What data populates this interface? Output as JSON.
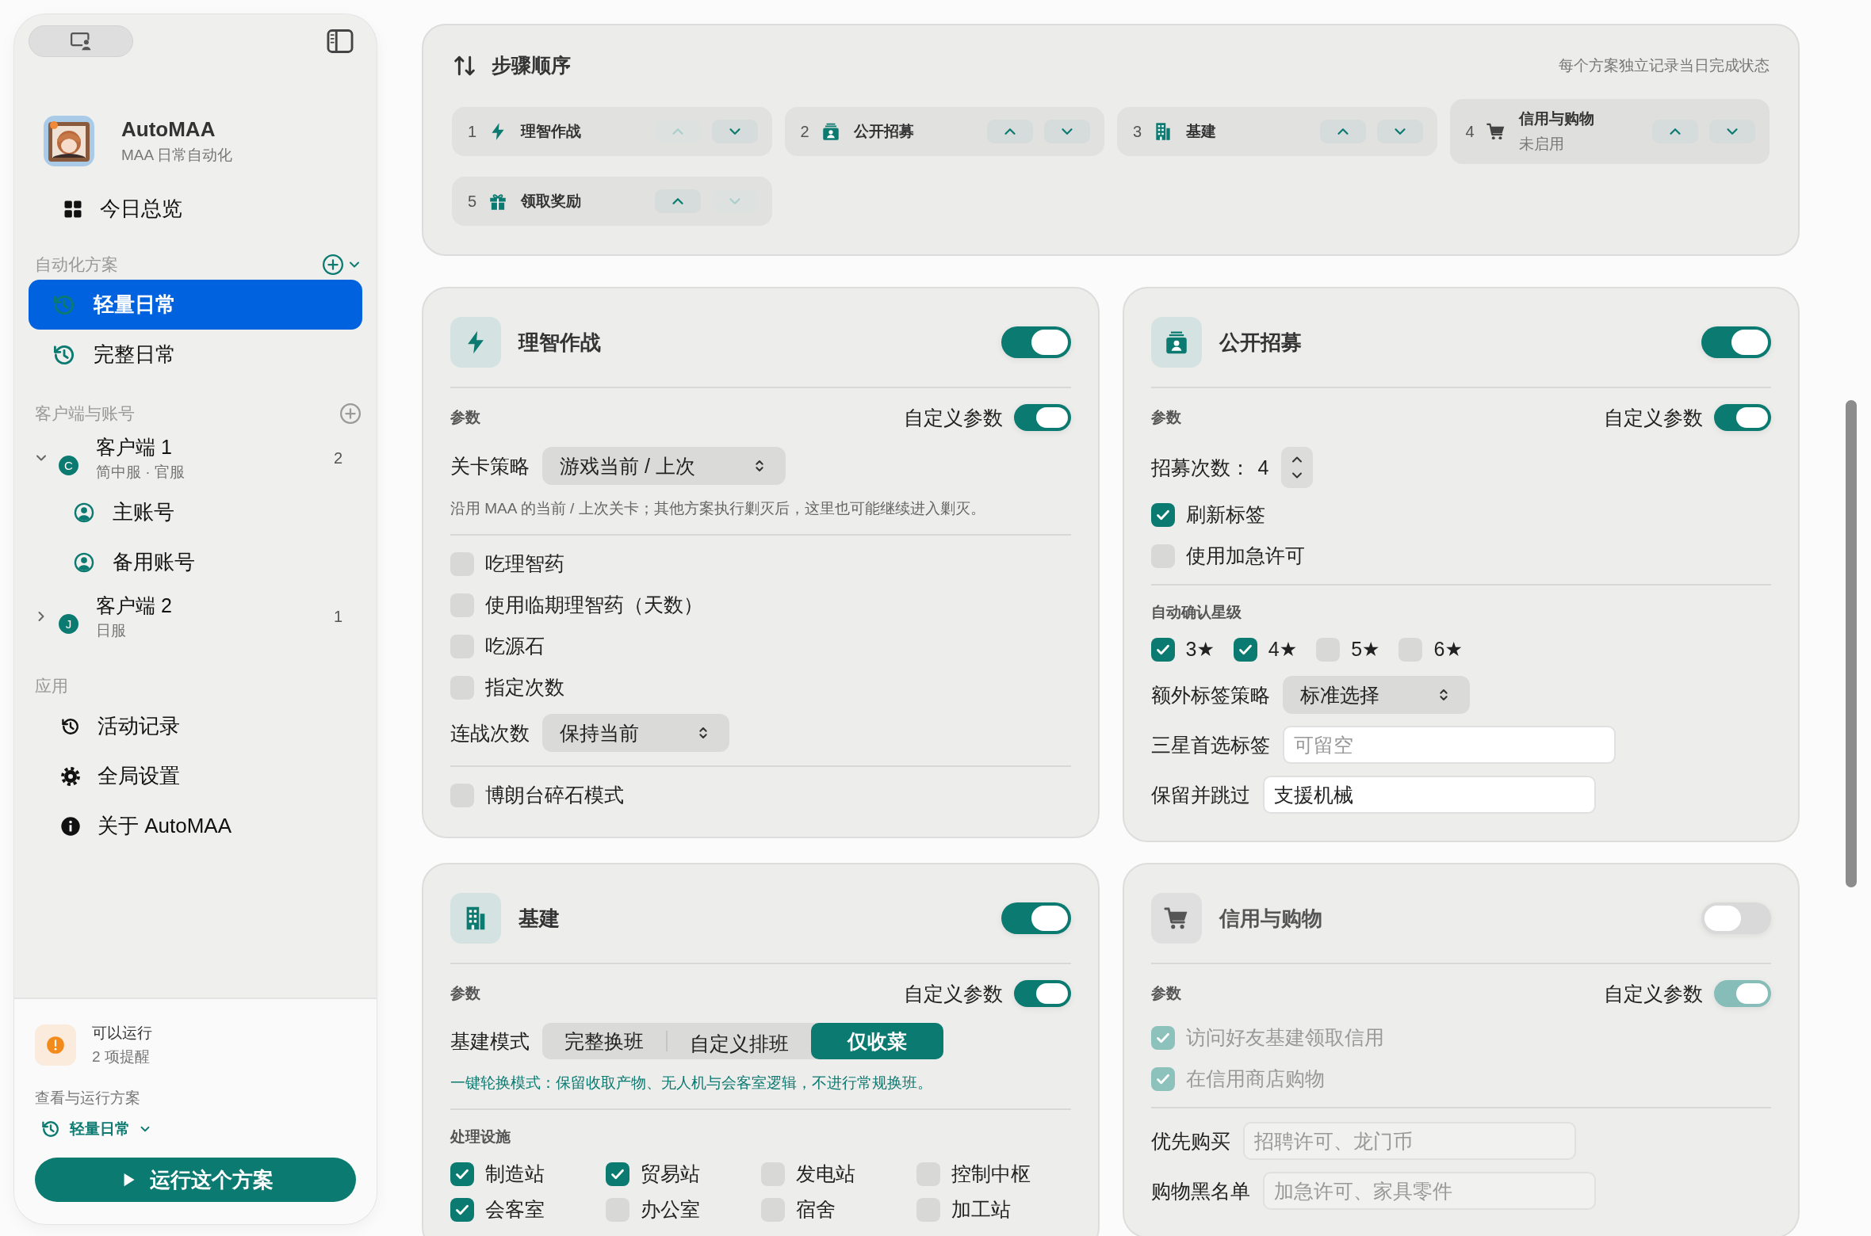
{
  "sidebar": {
    "app": {
      "name": "AutoMAA",
      "subtitle": "MAA 日常自动化"
    },
    "overview": "今日总览",
    "plans_header": "自动化方案",
    "plans": [
      {
        "label": "轻量日常",
        "selected": true
      },
      {
        "label": "完整日常",
        "selected": false
      }
    ],
    "clients_header": "客户端与账号",
    "clients": [
      {
        "name": "客户端 1",
        "badge": "C",
        "detail": "简中服 · 官服",
        "count": "2",
        "expanded": true,
        "children": [
          {
            "label": "主账号"
          },
          {
            "label": "备用账号"
          }
        ]
      },
      {
        "name": "客户端 2",
        "badge": "J",
        "detail": "日服",
        "count": "1",
        "expanded": false
      }
    ],
    "apps_header": "应用",
    "apps": [
      {
        "label": "活动记录",
        "kind": "history"
      },
      {
        "label": "全局设置",
        "kind": "settings"
      },
      {
        "label": "关于 AutoMAA",
        "kind": "info"
      }
    ],
    "status": {
      "title": "可以运行",
      "detail": "2 项提醒"
    },
    "run_label": "查看与运行方案",
    "run_plan": "轻量日常",
    "run_button": "运行这个方案"
  },
  "steps": {
    "title": "步骤顺序",
    "note": "每个方案独立记录当日完成状态",
    "items": [
      {
        "index": "1",
        "label": "理智作战",
        "kind": "bolt",
        "up_disabled": true,
        "down_disabled": false
      },
      {
        "index": "2",
        "label": "公开招募",
        "kind": "recruit",
        "up_disabled": false,
        "down_disabled": false
      },
      {
        "index": "3",
        "label": "基建",
        "kind": "building",
        "up_disabled": false,
        "down_disabled": false
      },
      {
        "index": "4",
        "label": "信用与购物",
        "status": "未启用",
        "kind": "cart",
        "up_disabled": false,
        "down_disabled": false
      },
      {
        "index": "5",
        "label": "领取奖励",
        "kind": "gift",
        "up_disabled": false,
        "down_disabled": true
      }
    ]
  },
  "cards": [
    {
      "title": "理智作战",
      "kind": "bolt",
      "enabled": true,
      "params_label": "参数",
      "custom_label": "自定义参数",
      "custom": true,
      "rows": [
        {
          "kind": "select",
          "label": "关卡策略",
          "value": "游戏当前 / 上次"
        },
        {
          "kind": "hint",
          "text": "沿用 MAA 的当前 / 上次关卡；其他方案执行剿灭后，这里也可能继续进入剿灭。"
        },
        {
          "kind": "divider"
        },
        {
          "kind": "checkbox",
          "label": "吃理智药",
          "checked": false
        },
        {
          "kind": "checkbox",
          "label": "使用临期理智药（天数）",
          "checked": false
        },
        {
          "kind": "checkbox",
          "label": "吃源石",
          "checked": false
        },
        {
          "kind": "checkbox",
          "label": "指定次数",
          "checked": false
        },
        {
          "kind": "select",
          "label": "连战次数",
          "value": "保持当前"
        },
        {
          "kind": "divider"
        },
        {
          "kind": "checkbox",
          "label": "博朗台碎石模式",
          "checked": false
        }
      ]
    },
    {
      "title": "公开招募",
      "kind": "recruit",
      "enabled": true,
      "params_label": "参数",
      "custom_label": "自定义参数",
      "custom": true,
      "rows": [
        {
          "kind": "stepper",
          "label": "招募次数：",
          "value": "4"
        },
        {
          "kind": "checkbox",
          "label": "刷新标签",
          "checked": true
        },
        {
          "kind": "checkbox",
          "label": "使用加急许可",
          "checked": false
        },
        {
          "kind": "divider"
        },
        {
          "kind": "section",
          "label": "自动确认星级"
        },
        {
          "kind": "check_group",
          "items": [
            {
              "label": "3★",
              "checked": true
            },
            {
              "label": "4★",
              "checked": true
            },
            {
              "label": "5★",
              "checked": false
            },
            {
              "label": "6★",
              "checked": false
            }
          ]
        },
        {
          "kind": "select",
          "label": "额外标签策略",
          "value": "标准选择"
        },
        {
          "kind": "input",
          "label": "三星首选标签",
          "placeholder": "可留空"
        },
        {
          "kind": "input",
          "label": "保留并跳过",
          "value": "支援机械"
        }
      ]
    },
    {
      "title": "基建",
      "kind": "building",
      "enabled": true,
      "params_label": "参数",
      "custom_label": "自定义参数",
      "custom": true,
      "rows": [
        {
          "kind": "segmented",
          "label": "基建模式",
          "options": [
            {
              "label": "完整换班",
              "selected": false
            },
            {
              "label": "自定义排班",
              "selected": false
            },
            {
              "label": "仅收菜",
              "selected": true
            }
          ]
        },
        {
          "kind": "mode_hint",
          "text": "一键轮换模式：保留收取产物、无人机与会客室逻辑，不进行常规换班。"
        },
        {
          "kind": "divider"
        },
        {
          "kind": "section",
          "label": "处理设施"
        },
        {
          "kind": "check_grid",
          "items": [
            {
              "label": "制造站",
              "checked": true
            },
            {
              "label": "贸易站",
              "checked": true
            },
            {
              "label": "发电站",
              "checked": false
            },
            {
              "label": "控制中枢",
              "checked": false
            },
            {
              "label": "会客室",
              "checked": true
            },
            {
              "label": "办公室",
              "checked": false
            },
            {
              "label": "宿舍",
              "checked": false
            },
            {
              "label": "加工站",
              "checked": false
            }
          ]
        }
      ]
    },
    {
      "title": "信用与购物",
      "kind": "cart",
      "enabled": false,
      "params_label": "参数",
      "custom_label": "自定义参数",
      "custom": true,
      "rows": [
        {
          "kind": "checkbox",
          "label": "访问好友基建领取信用",
          "checked": true
        },
        {
          "kind": "checkbox",
          "label": "在信用商店购物",
          "checked": true
        },
        {
          "kind": "divider"
        },
        {
          "kind": "input",
          "label": "优先购买",
          "placeholder": "招聘许可、龙门币"
        },
        {
          "kind": "input",
          "label": "购物黑名单",
          "placeholder": "加急许可、家具零件"
        }
      ]
    }
  ]
}
